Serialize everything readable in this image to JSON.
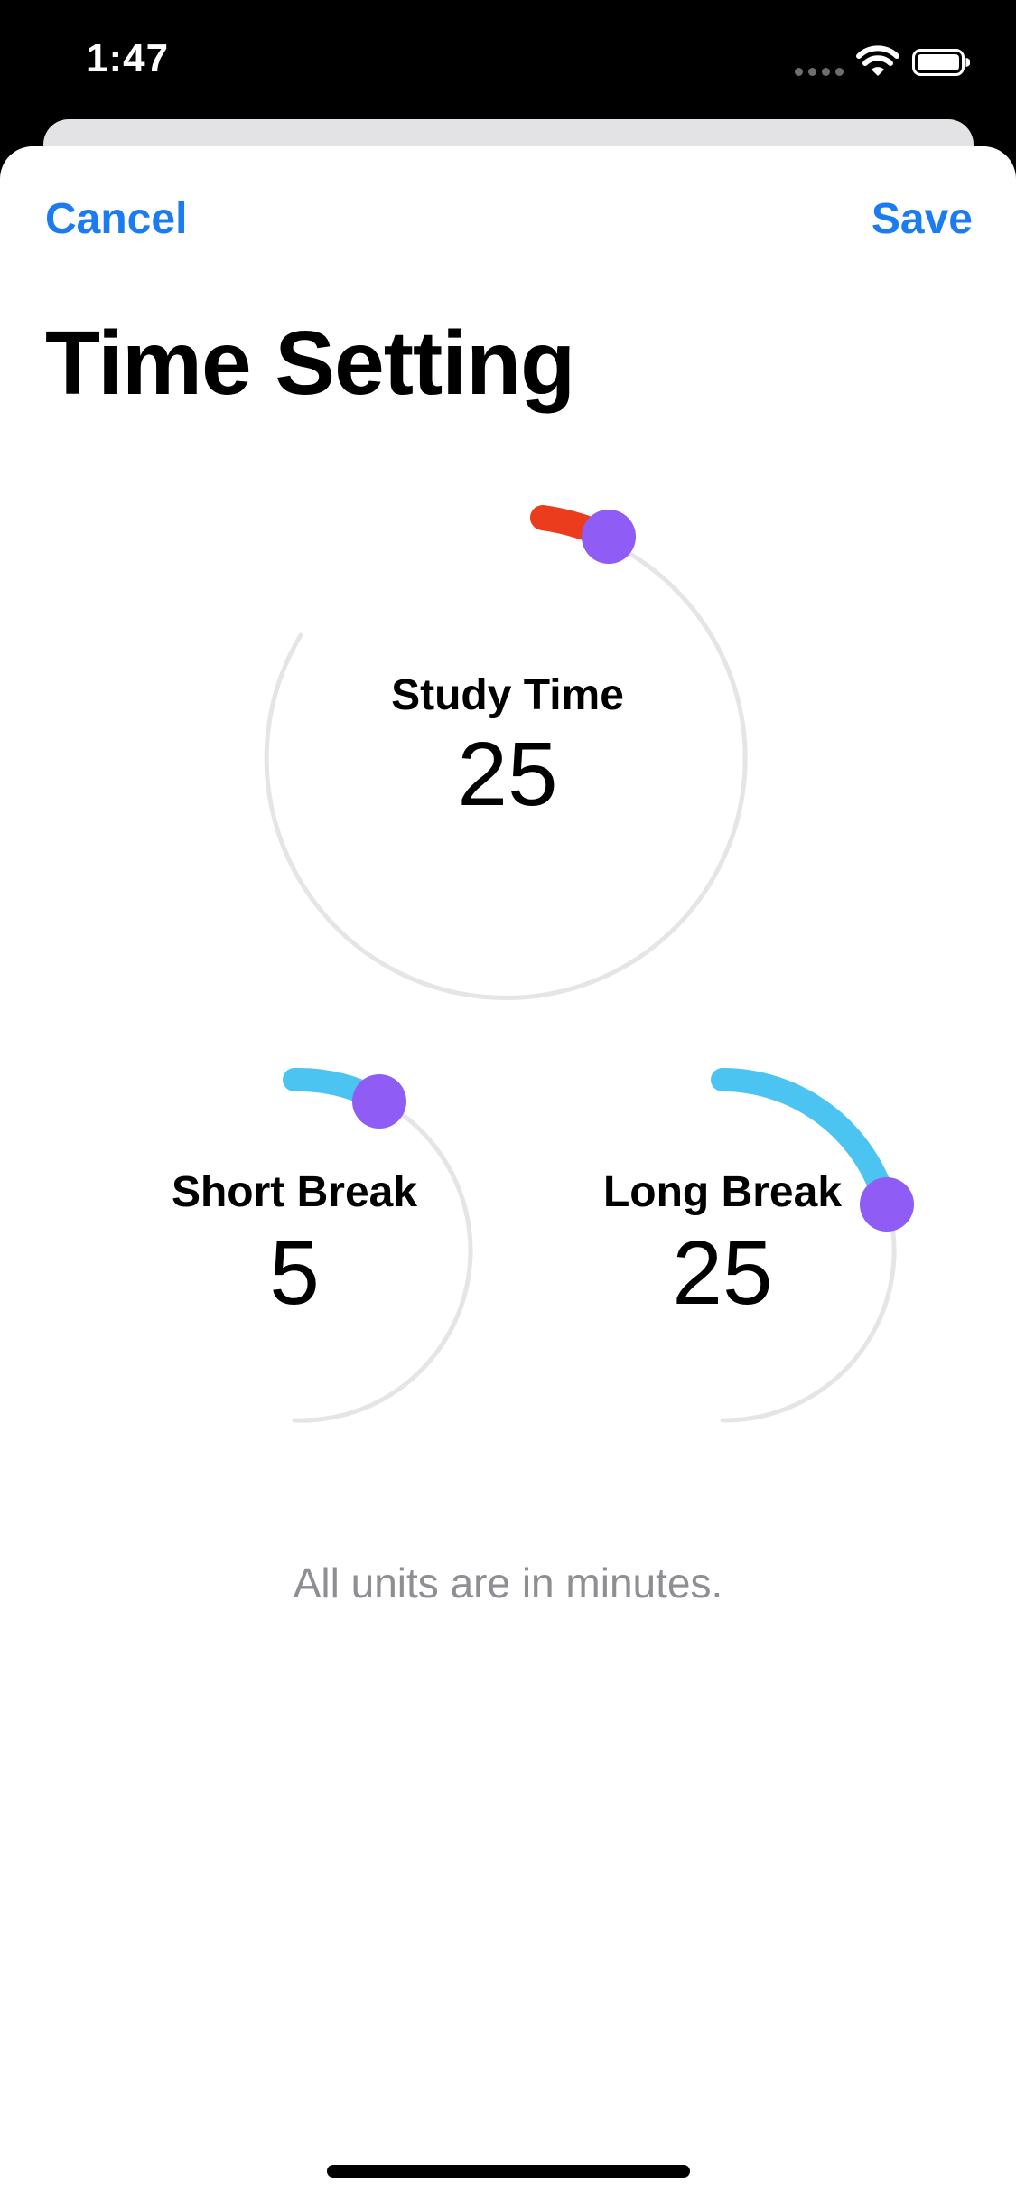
{
  "status_bar": {
    "time": "1:47",
    "signal_icon": "signal-dots-icon",
    "wifi_icon": "wifi-icon",
    "battery_icon": "battery-icon"
  },
  "nav": {
    "cancel_label": "Cancel",
    "save_label": "Save"
  },
  "page": {
    "title": "Time Setting",
    "footnote": "All units are in minutes."
  },
  "dials": {
    "study": {
      "label": "Study Time",
      "value": "25",
      "arc_color": "#ec3c1e",
      "knob_color": "#8f5cf5",
      "level_fraction": 0.055
    },
    "short_break": {
      "label": "Short Break",
      "value": "5",
      "arc_color": "#4cc4f2",
      "knob_color": "#8f5cf5",
      "level_fraction": 0.1
    },
    "long_break": {
      "label": "Long Break",
      "value": "25",
      "arc_color": "#4cc4f2",
      "knob_color": "#8f5cf5",
      "level_fraction": 0.35
    }
  },
  "colors": {
    "accent": "#1b7cf2",
    "track": "#e5e5e7",
    "secondary_text": "#8e8e93"
  }
}
